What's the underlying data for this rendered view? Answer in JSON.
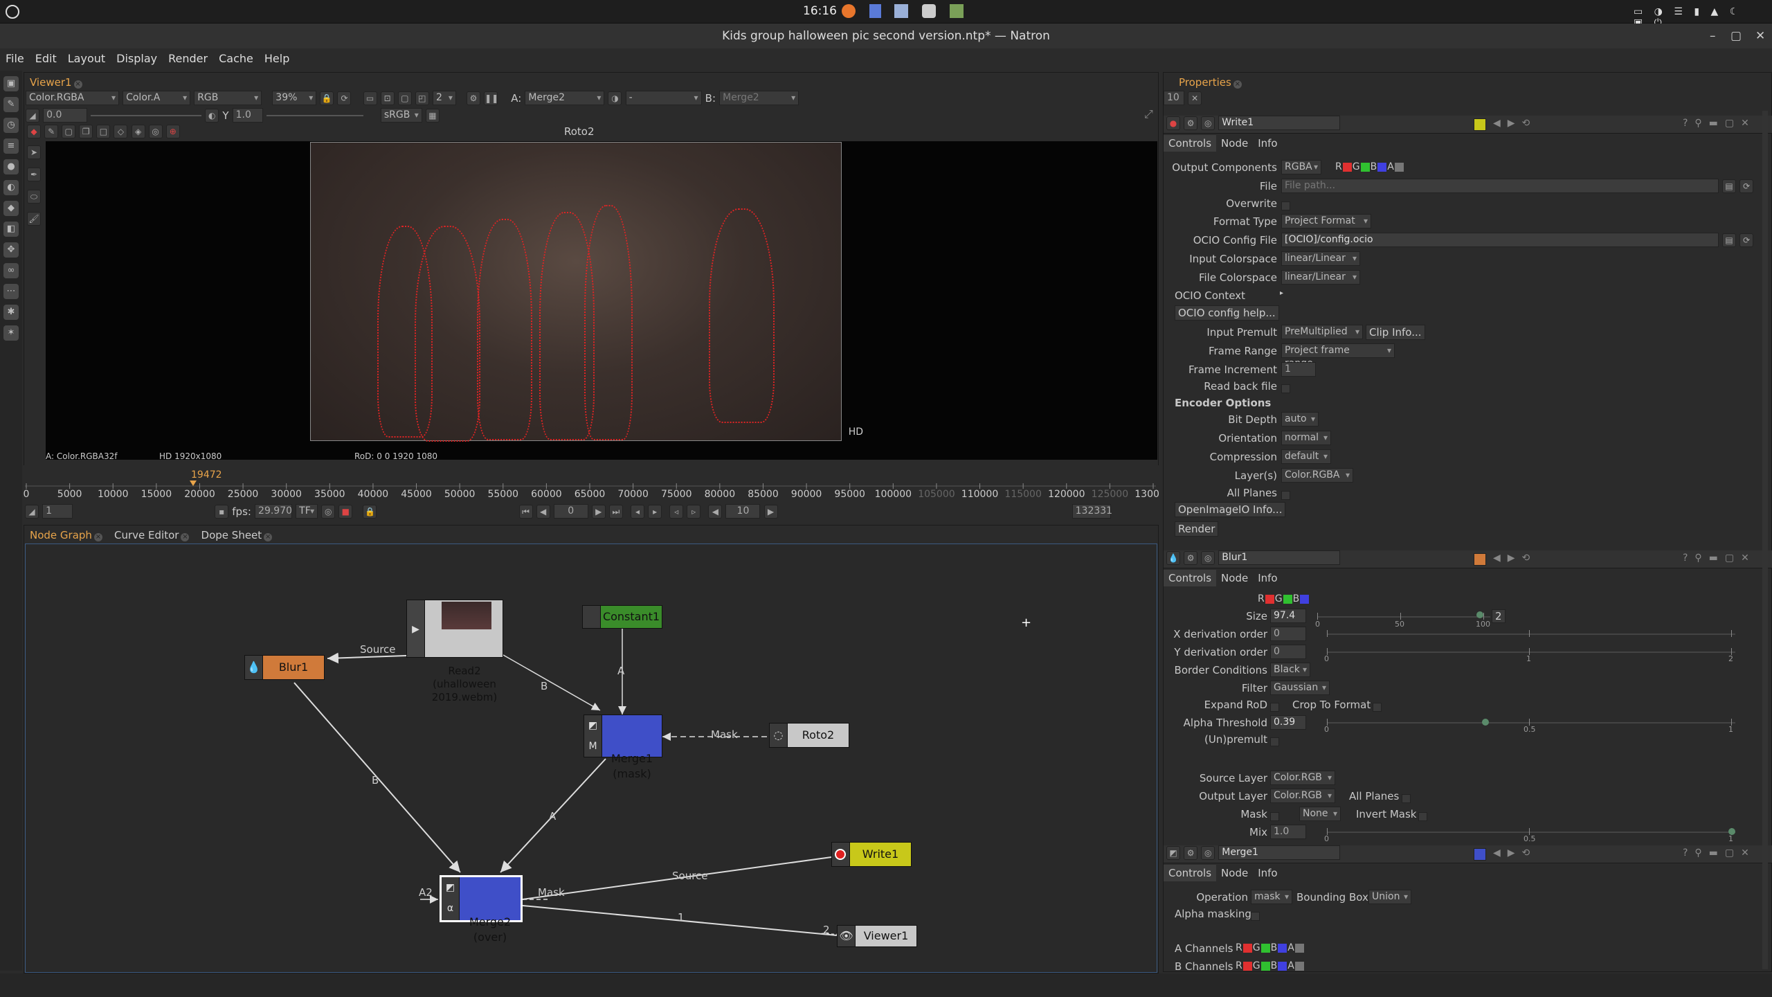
{
  "system_bar": {
    "time": "16:16"
  },
  "window_title": "Kids group halloween pic second version.ntp* — Natron",
  "menu": [
    "File",
    "Edit",
    "Layout",
    "Display",
    "Render",
    "Cache",
    "Help"
  ],
  "viewer": {
    "tab": "Viewer1",
    "layer": "Color.RGBA",
    "alpha": "Color.A",
    "channels": "RGB",
    "zoom": "39%",
    "proxy": "2",
    "a_label": "A:",
    "a_input": "Merge2",
    "b_label": "B:",
    "b_input": "Merge2",
    "op": "-",
    "gain": "0.0",
    "gamma_label": "Y",
    "gamma": "1.0",
    "colorspace": "sRGB",
    "roto_title": "Roto2",
    "hd_label": "HD",
    "info_format": "A: Color.RGBA32f",
    "info_res": "HD 1920x1080",
    "info_rod": "RoD: 0 0 1920 1080"
  },
  "timeline": {
    "current_frame_marker": "19472",
    "ticks": [
      "0",
      "5000",
      "10000",
      "15000",
      "20000",
      "25000",
      "30000",
      "35000",
      "40000",
      "45000",
      "50000",
      "55000",
      "60000",
      "65000",
      "70000",
      "75000",
      "80000",
      "85000",
      "90000",
      "95000",
      "100000",
      "105000",
      "110000",
      "115000",
      "120000",
      "125000",
      "130000"
    ],
    "start": "1",
    "fps_label": "fps:",
    "fps": "29.970",
    "tf": "TF",
    "frame": "0",
    "step": "10",
    "end": "132331"
  },
  "nodegraph": {
    "tabs": [
      "Node Graph",
      "Curve Editor",
      "Dope Sheet"
    ],
    "nodes": {
      "read2": "Read2\n(uhalloween\n2019.webm)",
      "constant1": "Constant1",
      "blur1": "Blur1",
      "merge1": "Merge1\n(mask)",
      "roto2": "Roto2",
      "merge2": "Merge2\n(over)",
      "write1": "Write1",
      "viewer1": "Viewer1"
    },
    "edge_labels": {
      "source_blur": "Source",
      "b_read": "B",
      "a_constant": "A",
      "mask_roto": "Mask",
      "b_blur": "B",
      "a_merge1": "A",
      "source_write": "Source",
      "a2": "A2",
      "mask_merge2": "Mask",
      "one": "1",
      "two": "2"
    }
  },
  "properties": {
    "tab": "Properties",
    "max_panels": "10",
    "write1": {
      "name": "Write1",
      "subtabs": [
        "Controls",
        "Node",
        "Info"
      ],
      "output_components_label": "Output Components",
      "output_components": "RGBA",
      "file_label": "File",
      "file_placeholder": "File path...",
      "overwrite_label": "Overwrite",
      "format_type_label": "Format Type",
      "format_type": "Project Format",
      "ocio_config_label": "OCIO Config File",
      "ocio_config": "[OCIO]/config.ocio",
      "input_cs_label": "Input Colorspace",
      "input_cs": "linear/Linear",
      "file_cs_label": "File Colorspace",
      "file_cs": "linear/Linear",
      "ocio_context_label": "OCIO Context",
      "ocio_help": "OCIO config help...",
      "input_premult_label": "Input Premult",
      "input_premult": "PreMultiplied",
      "clip_info": "Clip Info...",
      "frame_range_label": "Frame Range",
      "frame_range": "Project frame range",
      "frame_increment_label": "Frame Increment",
      "frame_increment": "1",
      "read_back_label": "Read back file",
      "encoder_options": "Encoder Options",
      "bit_depth_label": "Bit Depth",
      "bit_depth": "auto",
      "orientation_label": "Orientation",
      "orientation": "normal",
      "compression_label": "Compression",
      "compression": "default",
      "layers_label": "Layer(s)",
      "layers": "Color.RGBA",
      "all_planes_label": "All Planes",
      "oiio_info": "OpenImageIO Info...",
      "render": "Render"
    },
    "blur1": {
      "name": "Blur1",
      "subtabs": [
        "Controls",
        "Node",
        "Info"
      ],
      "size_label": "Size",
      "size": "97.4",
      "size_dim": "2",
      "size_ticks": [
        "0",
        "50",
        "100"
      ],
      "xderiv_label": "X derivation order",
      "xderiv": "0",
      "yderiv_label": "Y derivation order",
      "yderiv": "0",
      "deriv_ticks": [
        "0",
        "1",
        "2"
      ],
      "border_label": "Border Conditions",
      "border": "Black",
      "filter_label": "Filter",
      "filter": "Gaussian",
      "expand_rod_label": "Expand RoD",
      "crop_label": "Crop To Format",
      "alpha_thresh_label": "Alpha Threshold",
      "alpha_thresh": "0.39",
      "frac_ticks": [
        "0",
        "0.5",
        "1"
      ],
      "unpremult_label": "(Un)premult",
      "source_layer_label": "Source Layer",
      "source_layer": "Color.RGB",
      "output_layer_label": "Output Layer",
      "output_layer": "Color.RGB",
      "all_planes_label": "All Planes",
      "mask_label": "Mask",
      "mask": "None",
      "invert_mask_label": "Invert Mask",
      "mix_label": "Mix",
      "mix": "1.0"
    },
    "merge1": {
      "name": "Merge1",
      "subtabs": [
        "Controls",
        "Node",
        "Info"
      ],
      "operation_label": "Operation",
      "operation": "mask",
      "bbox_label": "Bounding Box",
      "bbox": "Union",
      "alpha_masking_label": "Alpha masking",
      "a_channels_label": "A Channels",
      "b_channels_label": "B Channels"
    }
  },
  "colors": {
    "write_node": "#c8c81a",
    "blur_node": "#d07a3a",
    "merge_node": "#3f4fc8",
    "constant_node": "#3a8c2a",
    "roto_color": "#e02424",
    "accent": "#e8a44a"
  }
}
